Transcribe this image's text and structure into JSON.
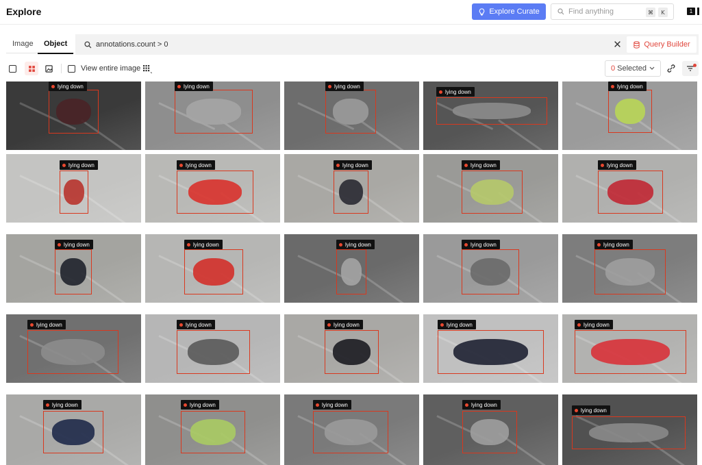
{
  "header": {
    "title": "Explore",
    "curate_label": "Explore Curate",
    "search_placeholder": "Find anything",
    "shortcut_mod": "⌘",
    "shortcut_key": "K",
    "colors": {
      "accent": "#5b7cf4",
      "danger": "#e0463c"
    }
  },
  "tabs": [
    {
      "label": "Image",
      "active": false
    },
    {
      "label": "Object",
      "active": true
    }
  ],
  "query": {
    "text": "annotations.count > 0",
    "builder_label": "Query Builder"
  },
  "toolbar": {
    "view_entire_label": "View entire image",
    "selected_count": "0",
    "selected_label": "Selected"
  },
  "grid": {
    "label": "lying down",
    "cells": [
      {
        "id": 1,
        "bg": "#3a3a3a",
        "subject": "#4a2327"
      },
      {
        "id": 2,
        "bg": "#8e8e8e",
        "subject": "#a5a5a5"
      },
      {
        "id": 3,
        "bg": "#6d6d6d",
        "subject": "#9a9a9a"
      },
      {
        "id": 4,
        "bg": "#555555",
        "subject": "#8c8c8c"
      },
      {
        "id": 5,
        "bg": "#9b9b9b",
        "subject": "#b9d657"
      },
      {
        "id": 6,
        "bg": "#c4c4c2",
        "subject": "#b8342d"
      },
      {
        "id": 7,
        "bg": "#b9b9b6",
        "subject": "#d9322c"
      },
      {
        "id": 8,
        "bg": "#a9a8a4",
        "subject": "#2a2a33"
      },
      {
        "id": 9,
        "bg": "#9a9a97",
        "subject": "#b6c96a"
      },
      {
        "id": 10,
        "bg": "#b0b0ae",
        "subject": "#c12834"
      },
      {
        "id": 11,
        "bg": "#a4a4a0",
        "subject": "#20232c"
      },
      {
        "id": 12,
        "bg": "#b6b6b4",
        "subject": "#d3302a"
      },
      {
        "id": 13,
        "bg": "#6a6a6a",
        "subject": "#a4a4a4"
      },
      {
        "id": 14,
        "bg": "#9a9a9a",
        "subject": "#6a6a6a"
      },
      {
        "id": 15,
        "bg": "#7d7d7d",
        "subject": "#9e9e9e"
      },
      {
        "id": 16,
        "bg": "#707070",
        "subject": "#8c8c8c"
      },
      {
        "id": 17,
        "bg": "#b6b6b6",
        "subject": "#5a5a5a"
      },
      {
        "id": 18,
        "bg": "#a9a8a5",
        "subject": "#1c1c22"
      },
      {
        "id": 19,
        "bg": "#c0c0c0",
        "subject": "#1f2233"
      },
      {
        "id": 20,
        "bg": "#b2b2b0",
        "subject": "#d8323a"
      },
      {
        "id": 21,
        "bg": "#a9a9a7",
        "subject": "#1f2a4a"
      },
      {
        "id": 22,
        "bg": "#8f8f8d",
        "subject": "#aacb63"
      },
      {
        "id": 23,
        "bg": "#7a7a7a",
        "subject": "#9a9a9a"
      },
      {
        "id": 24,
        "bg": "#5f5f5f",
        "subject": "#9f9f9f"
      },
      {
        "id": 25,
        "bg": "#515151",
        "subject": "#8a8a8a"
      }
    ]
  }
}
